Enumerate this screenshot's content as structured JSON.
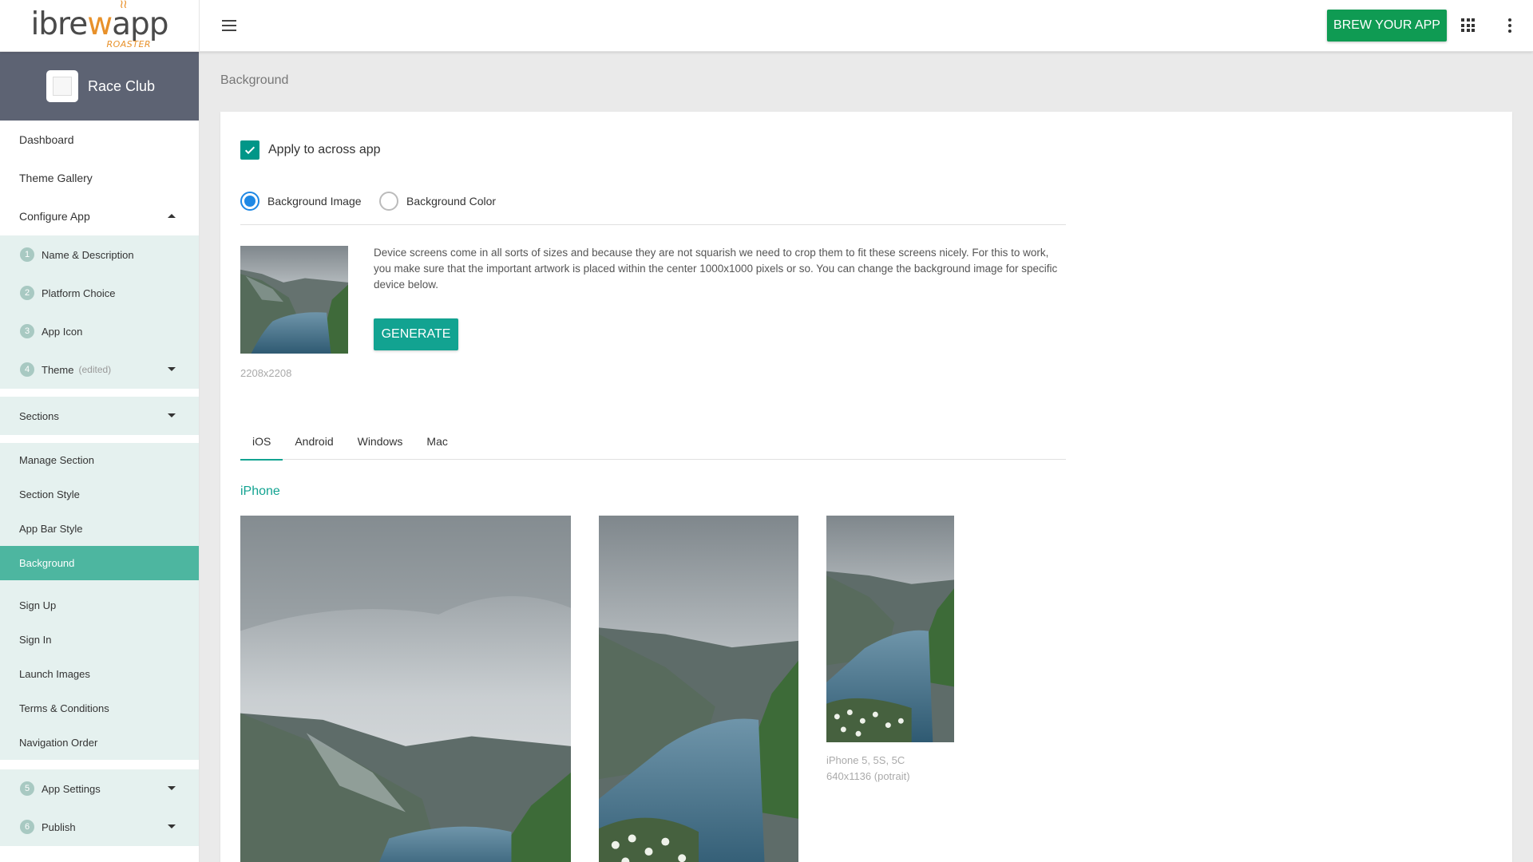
{
  "header": {
    "logo_text_left": "ibre",
    "logo_text_mid": "w",
    "logo_text_right": "app",
    "logo_sub": "ROASTER",
    "brew_button": "BREW YOUR APP"
  },
  "sidebar": {
    "project_name": "Race Club",
    "items": [
      {
        "label": "Dashboard"
      },
      {
        "label": "Theme Gallery"
      },
      {
        "label": "Configure App"
      }
    ],
    "configure_steps": [
      {
        "num": "1",
        "label": "Name & Description"
      },
      {
        "num": "2",
        "label": "Platform Choice"
      },
      {
        "num": "3",
        "label": "App Icon"
      },
      {
        "num": "4",
        "label": "Theme",
        "note": "(edited)"
      }
    ],
    "sections_label": "Sections",
    "section_items": [
      {
        "label": "Manage Section"
      },
      {
        "label": "Section Style"
      },
      {
        "label": "App Bar Style"
      },
      {
        "label": "Background"
      }
    ],
    "other_items": [
      {
        "label": "Sign Up"
      },
      {
        "label": "Sign In"
      },
      {
        "label": "Launch Images"
      },
      {
        "label": "Terms & Conditions"
      },
      {
        "label": "Navigation Order"
      }
    ],
    "final_steps": [
      {
        "num": "5",
        "label": "App Settings"
      },
      {
        "num": "6",
        "label": "Publish"
      }
    ],
    "active_item": "Background"
  },
  "main": {
    "breadcrumb": "Background",
    "apply_checkbox_label": "Apply to across app",
    "apply_checked": true,
    "radio_image": "Background Image",
    "radio_color": "Background Color",
    "selected_radio": "Background Image",
    "description": "Device screens come in all sorts of sizes and because they are not squarish we need to crop them to fit these screens nicely. For this to work, you make sure that the important artwork is placed within the center 1000x1000 pixels or so. You can change the background image for specific device below.",
    "generate_button": "GENERATE",
    "source_size": "2208x2208",
    "tabs": [
      {
        "label": "iOS"
      },
      {
        "label": "Android"
      },
      {
        "label": "Windows"
      },
      {
        "label": "Mac"
      }
    ],
    "active_tab": "iOS",
    "section_title": "iPhone",
    "devices": [
      {
        "caption_line1": "iPhone 5, 5S, 5C",
        "caption_line2": "640x1136 (potrait)"
      }
    ]
  },
  "colors": {
    "accent": "#12a391",
    "brew_green": "#0f9b53",
    "sidebar_active": "#4db6a0",
    "sidebar_sub_bg": "#e5f1ef",
    "project_header": "#5d6373",
    "radio_blue": "#1e88e5"
  },
  "icons": [
    "hamburger-menu-icon",
    "apps-grid-icon",
    "more-vert-icon",
    "check-icon",
    "caret-up-icon",
    "caret-down-icon",
    "app-placeholder-icon"
  ]
}
